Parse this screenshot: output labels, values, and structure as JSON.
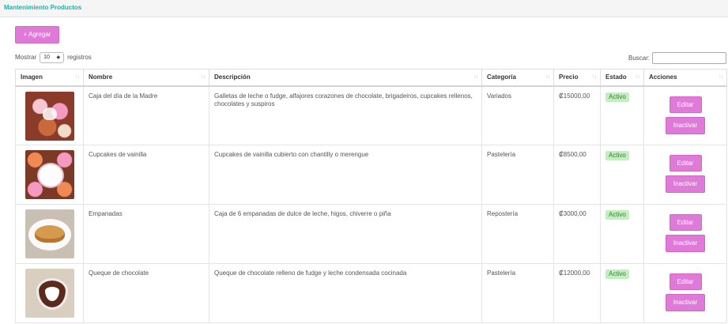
{
  "header": {
    "title": "Mantenimiento Productos"
  },
  "toolbar": {
    "add_label": "+ Agregar"
  },
  "length_control": {
    "prefix": "Mostrar",
    "value": "10",
    "suffix": "registros"
  },
  "search": {
    "label": "Buscar:",
    "value": ""
  },
  "table": {
    "columns": [
      "Imagen",
      "Nombre",
      "Descripción",
      "Categoría",
      "Precio",
      "Estado",
      "Acciones"
    ],
    "rows": [
      {
        "image": "cake-gift-box-image",
        "name": "Caja del día de la Madre",
        "description": "Galletas de leche o fudge, alfajores corazones de chocolate, brigadeiros, cupcakes rellenos, chocolates y suspiros",
        "category": "Variados",
        "price": "₡15000,00",
        "status": "Activo"
      },
      {
        "image": "vanilla-cupcakes-image",
        "name": "Cupcakes de vainilla",
        "description": "Cupcakes de vainilla cubierto con chantilly o merengue",
        "category": "Pastelería",
        "price": "₡8500,00",
        "status": "Activo"
      },
      {
        "image": "empanadas-image",
        "name": "Empanadas",
        "description": "Caja de 6 empanadas de dulce de leche, higos, chiverre o piña",
        "category": "Repostería",
        "price": "₡3000,00",
        "status": "Activo"
      },
      {
        "image": "chocolate-cake-image",
        "name": "Queque de chocolate",
        "description": "Queque de chocolate relleno de fudge y leche condensada cocinada",
        "category": "Pastelería",
        "price": "₡12000,00",
        "status": "Activo"
      }
    ],
    "edit_label": "Editar",
    "inactivate_label": "Inactivar",
    "sort_glyph": "↑↓"
  },
  "colors": {
    "accent": "#e07ad8",
    "title": "#1ab3a8",
    "badge_bg": "#c3efc0"
  }
}
